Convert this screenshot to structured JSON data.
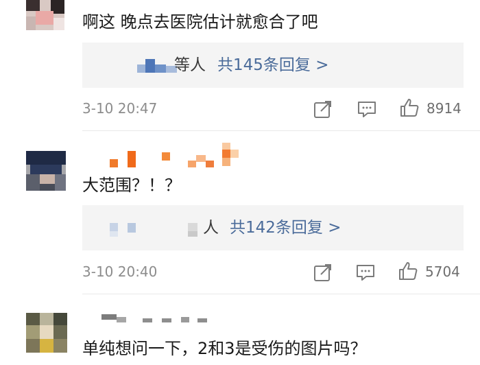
{
  "comments": [
    {
      "text": "啊这 晚点去医院估计就愈合了吧",
      "reply_suffix": "等人",
      "reply_link": "共145条回复 >",
      "time": "3-10 20:47",
      "likes": "8914"
    },
    {
      "text": "大范围？！？",
      "reply_suffix": "人",
      "reply_link": "共142条回复 >",
      "time": "3-10 20:40",
      "likes": "5704"
    },
    {
      "text": "单纯想问一下，2和3是受伤的图片吗？"
    }
  ],
  "icons": {
    "share": "share-icon",
    "comment": "comment-icon",
    "like": "thumbs-up-icon"
  },
  "colors": {
    "link": "#4a6b9a",
    "meta": "#8c8c8c",
    "reply_bg": "#f4f4f4"
  }
}
